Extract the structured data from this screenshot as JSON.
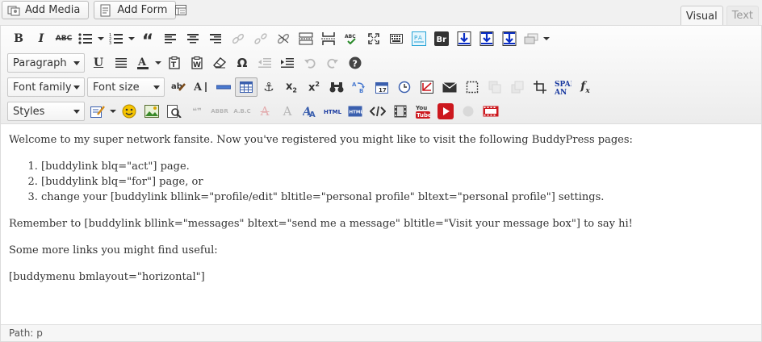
{
  "media_buttons": {
    "add_media": "Add Media",
    "add_form": "Add Form"
  },
  "tabs": {
    "visual": "Visual",
    "text": "Text"
  },
  "toolbar": {
    "format_select": "Paragraph",
    "font_family_select": "Font family",
    "font_size_select": "Font size",
    "styles_select": "Styles"
  },
  "content": {
    "intro": "Welcome to my super network fansite. Now you've registered you might like to visit the following BuddyPress pages:",
    "list": [
      "[buddylink blq=\"act\"] page.",
      "[buddylink blq=\"for\"] page, or",
      "change your [buddylink bllink=\"profile/edit\" bltitle=\"personal profile\" bltext=\"personal profile\"] settings."
    ],
    "reminder": "Remember to [buddylink bllink=\"messages\" bltext=\"send me a message\" bltitle=\"Visit your message box\"] to say hi!",
    "more": "Some more links you might find useful:",
    "menu_shortcode": "[buddymenu bmlayout=\"horizontal\"]"
  },
  "statusbar": {
    "path": "Path: p"
  },
  "icons": {
    "youtube_label": "You Tube",
    "html_label": "HTML",
    "span_label": "SPAN"
  },
  "colors": {
    "accent_blue": "#0a2ec4",
    "youtube_red": "#cc181e",
    "smiley_yellow": "#f5c400"
  }
}
